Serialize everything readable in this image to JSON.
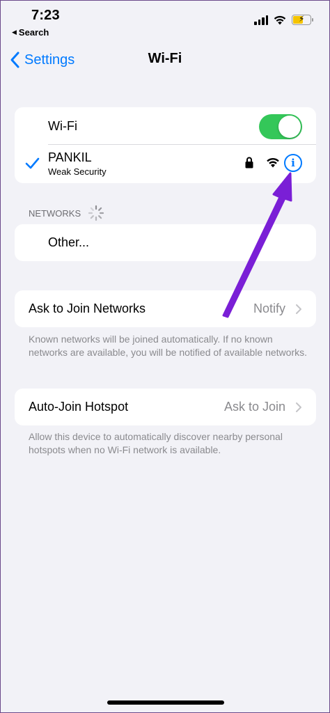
{
  "status_bar": {
    "time": "7:23",
    "back_app": "Search",
    "battery_color": "#f5c400"
  },
  "nav": {
    "back_label": "Settings",
    "title": "Wi-Fi"
  },
  "wifi_card": {
    "wifi_label": "Wi-Fi",
    "wifi_toggle_on": true,
    "connected_network": {
      "name": "PANKIL",
      "subtitle": "Weak Security",
      "icons": [
        "checkmark-icon",
        "lock-icon",
        "wifi-signal-icon",
        "info-icon"
      ]
    }
  },
  "networks_section": {
    "header": "NETWORKS",
    "other_label": "Other..."
  },
  "ask_to_join": {
    "label": "Ask to Join Networks",
    "value": "Notify",
    "footnote": "Known networks will be joined automatically. If no known networks are available, you will be notified of available networks."
  },
  "auto_join_hotspot": {
    "label": "Auto-Join Hotspot",
    "value": "Ask to Join",
    "footnote": "Allow this device to automatically discover nearby personal hotspots when no Wi-Fi network is available."
  },
  "colors": {
    "accent": "#007aff",
    "toggle_on": "#34c759",
    "annotation_arrow": "#7a1fd6",
    "background": "#f2f2f7"
  }
}
